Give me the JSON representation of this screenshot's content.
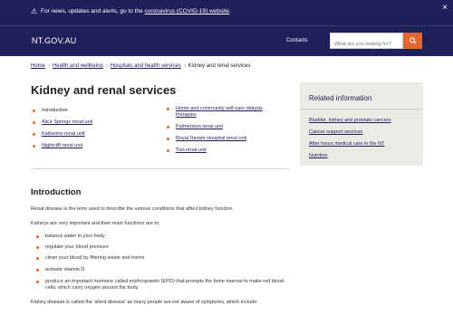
{
  "alert": {
    "text": "For news, updates and alerts, go to the",
    "link": "coronavirus (COVID-19) website",
    "end": ".",
    "close": "×"
  },
  "header": {
    "logo": "NT.GOV.AU",
    "contacts": "Contacts",
    "search_placeholder": "What are you looking for?"
  },
  "breadcrumb": [
    "Home",
    "Health and wellbeing",
    "Hospitals and health services",
    "Kidney and renal services"
  ],
  "page": {
    "title": "Kidney and renal services"
  },
  "toc": {
    "left": [
      "Introduction",
      "Alice Springs renal unit",
      "Katherine renal unit",
      "Nightcliff renal unit"
    ],
    "right": [
      "Home and community self-care dialysis therapies",
      "Palmerston renal unit",
      "Royal Darwin Hospital renal unit",
      "Tiwi renal unit"
    ]
  },
  "related": {
    "title": "Related information",
    "links": [
      "Bladder, kidney and prostate cancers",
      "Cancer support services",
      "After hours medical care in the NT",
      "Nutrition"
    ]
  },
  "intro": {
    "heading": "Introduction",
    "p1": "Renal disease is the term used to describe the various conditions that affect kidney function.",
    "p2": "Kidneys are very important and their main functions are to;",
    "bullets": [
      "balance water in your body",
      "regulate your blood pressure",
      "clean your blood by filtering waste and toxins",
      "activate vitamin D",
      "produce an important hormone called erythropoietin (EPO) that prompts the bone marrow to make red blood cells, which carry oxygen around the body."
    ],
    "p3": "Kidney disease is called the 'silent disease' as many people are not aware of symptoms, which include:"
  },
  "colors": {
    "navy": "#1f1f5c",
    "accent": "#e0682b",
    "panel": "#eceae4"
  },
  "icons": {
    "alert": "warning-triangle-icon",
    "close": "close-icon",
    "search": "magnifier-icon",
    "separator": "chevron-right-icon"
  }
}
